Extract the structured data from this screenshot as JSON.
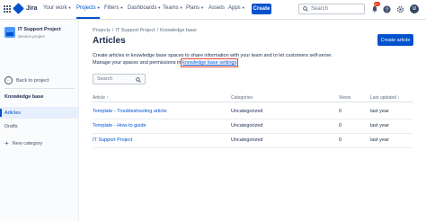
{
  "topnav": {
    "logo_text": "Jira",
    "items": [
      {
        "label": "Your work"
      },
      {
        "label": "Projects"
      },
      {
        "label": "Filters"
      },
      {
        "label": "Dashboards"
      },
      {
        "label": "Teams"
      },
      {
        "label": "Plans"
      },
      {
        "label": "Assets"
      },
      {
        "label": "Apps"
      }
    ],
    "create_label": "Create",
    "search_placeholder": "Search",
    "notification_count": "9+",
    "avatar_initials": "U",
    "accent_color": "#0052cc"
  },
  "sidebar": {
    "project_name": "IT Support Project",
    "project_type": "Service project",
    "back_label": "Back to project",
    "section_title": "Knowledge base",
    "items": [
      {
        "label": "Articles",
        "active": true
      },
      {
        "label": "Drafts",
        "active": false
      }
    ],
    "new_category_label": "New category"
  },
  "main": {
    "breadcrumb": [
      "Projects",
      "IT Support Project",
      "Knowledge base"
    ],
    "title": "Articles",
    "create_button": "Create article",
    "description_line1": "Create articles in knowledge base spaces to share information with your team and to let customers self-serve.",
    "description_line2_prefix": "Manage your spaces and permissions in ",
    "description_link": "knowledge base settings",
    "description_line2_suffix": ".",
    "search_placeholder": "Search",
    "table": {
      "columns": [
        "Article",
        "Categories",
        "Views",
        "Last updated"
      ],
      "rows": [
        {
          "article": "Template - Troubleshooting article",
          "category": "Uncategorized",
          "views": "0",
          "updated": "last year"
        },
        {
          "article": "Template - How-to guide",
          "category": "Uncategorized",
          "views": "0",
          "updated": "last year"
        },
        {
          "article": "IT Support Project",
          "category": "Uncategorized",
          "views": "0",
          "updated": "last year"
        }
      ]
    }
  }
}
